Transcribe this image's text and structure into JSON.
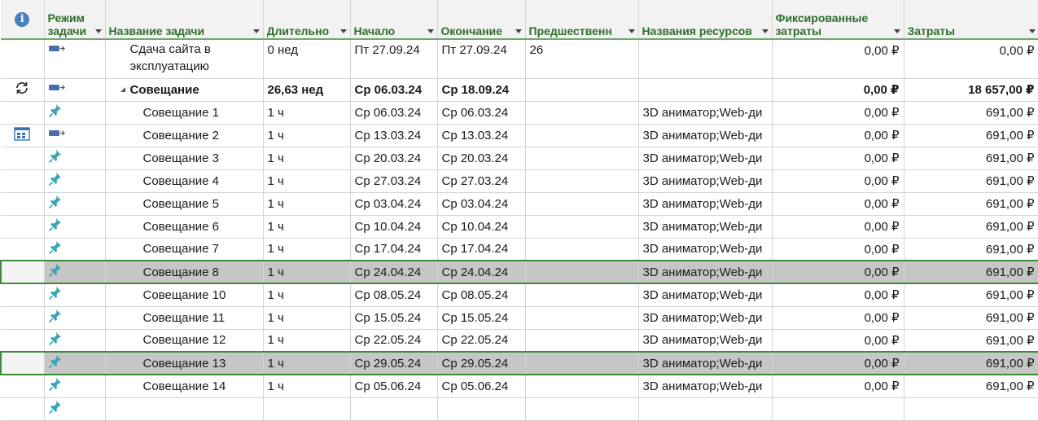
{
  "columns": {
    "info": "i",
    "mode": "Режим задачи",
    "name": "Название задачи",
    "duration": "Длительно",
    "start": "Начало",
    "finish": "Окончание",
    "predecessors": "Предшественн",
    "resources": "Названия ресурсов",
    "fixed_cost": "Фиксированные затраты",
    "cost": "Затраты"
  },
  "rows": [
    {
      "indicator": "",
      "mode_icon": "auto-scheduled-icon",
      "name": "Сдача сайта в эксплуатацию",
      "duration": "0 нед",
      "start": "Пт 27.09.24",
      "finish": "Пт 27.09.24",
      "predecessors": "26",
      "resources": "",
      "fixed_cost": "0,00 ₽",
      "cost": "0,00 ₽"
    },
    {
      "indicator": "recurring-icon",
      "mode_icon": "auto-scheduled-icon",
      "name": "Совещание",
      "duration": "26,63 нед",
      "start": "Ср 06.03.24",
      "finish": "Ср 18.09.24",
      "predecessors": "",
      "resources": "",
      "fixed_cost": "0,00 ₽",
      "cost": "18 657,00 ₽"
    },
    {
      "indicator": "",
      "mode_icon": "manual-pin-icon",
      "name": "Совещание 1",
      "duration": "1 ч",
      "start": "Ср 06.03.24",
      "finish": "Ср 06.03.24",
      "predecessors": "",
      "resources": "3D аниматор;Web-ди",
      "fixed_cost": "0,00 ₽",
      "cost": "691,00 ₽"
    },
    {
      "indicator": "calendar-icon",
      "mode_icon": "auto-scheduled-icon",
      "name": "Совещание 2",
      "duration": "1 ч",
      "start": "Ср 13.03.24",
      "finish": "Ср 13.03.24",
      "predecessors": "",
      "resources": "3D аниматор;Web-ди",
      "fixed_cost": "0,00 ₽",
      "cost": "691,00 ₽"
    },
    {
      "indicator": "",
      "mode_icon": "manual-pin-icon",
      "name": "Совещание 3",
      "duration": "1 ч",
      "start": "Ср 20.03.24",
      "finish": "Ср 20.03.24",
      "predecessors": "",
      "resources": "3D аниматор;Web-ди",
      "fixed_cost": "0,00 ₽",
      "cost": "691,00 ₽"
    },
    {
      "indicator": "",
      "mode_icon": "manual-pin-icon",
      "name": "Совещание 4",
      "duration": "1 ч",
      "start": "Ср 27.03.24",
      "finish": "Ср 27.03.24",
      "predecessors": "",
      "resources": "3D аниматор;Web-ди",
      "fixed_cost": "0,00 ₽",
      "cost": "691,00 ₽"
    },
    {
      "indicator": "",
      "mode_icon": "manual-pin-icon",
      "name": "Совещание 5",
      "duration": "1 ч",
      "start": "Ср 03.04.24",
      "finish": "Ср 03.04.24",
      "predecessors": "",
      "resources": "3D аниматор;Web-ди",
      "fixed_cost": "0,00 ₽",
      "cost": "691,00 ₽"
    },
    {
      "indicator": "",
      "mode_icon": "manual-pin-icon",
      "name": "Совещание 6",
      "duration": "1 ч",
      "start": "Ср 10.04.24",
      "finish": "Ср 10.04.24",
      "predecessors": "",
      "resources": "3D аниматор;Web-ди",
      "fixed_cost": "0,00 ₽",
      "cost": "691,00 ₽"
    },
    {
      "indicator": "",
      "mode_icon": "manual-pin-icon",
      "name": "Совещание 7",
      "duration": "1 ч",
      "start": "Ср 17.04.24",
      "finish": "Ср 17.04.24",
      "predecessors": "",
      "resources": "3D аниматор;Web-ди",
      "fixed_cost": "0,00 ₽",
      "cost": "691,00 ₽"
    },
    {
      "indicator": "",
      "mode_icon": "manual-pin-icon",
      "name": "Совещание 8",
      "duration": "1 ч",
      "start": "Ср 24.04.24",
      "finish": "Ср 24.04.24",
      "predecessors": "",
      "resources": "3D аниматор;Web-ди",
      "fixed_cost": "0,00 ₽",
      "cost": "691,00 ₽",
      "selected": true
    },
    {
      "indicator": "",
      "mode_icon": "manual-pin-icon",
      "name": "Совещание 10",
      "duration": "1 ч",
      "start": "Ср 08.05.24",
      "finish": "Ср 08.05.24",
      "predecessors": "",
      "resources": "3D аниматор;Web-ди",
      "fixed_cost": "0,00 ₽",
      "cost": "691,00 ₽"
    },
    {
      "indicator": "",
      "mode_icon": "manual-pin-icon",
      "name": "Совещание 11",
      "duration": "1 ч",
      "start": "Ср 15.05.24",
      "finish": "Ср 15.05.24",
      "predecessors": "",
      "resources": "3D аниматор;Web-ди",
      "fixed_cost": "0,00 ₽",
      "cost": "691,00 ₽"
    },
    {
      "indicator": "",
      "mode_icon": "manual-pin-icon",
      "name": "Совещание 12",
      "duration": "1 ч",
      "start": "Ср 22.05.24",
      "finish": "Ср 22.05.24",
      "predecessors": "",
      "resources": "3D аниматор;Web-ди",
      "fixed_cost": "0,00 ₽",
      "cost": "691,00 ₽"
    },
    {
      "indicator": "",
      "mode_icon": "manual-pin-icon",
      "name": "Совещание 13",
      "duration": "1 ч",
      "start": "Ср 29.05.24",
      "finish": "Ср 29.05.24",
      "predecessors": "",
      "resources": "3D аниматор;Web-ди",
      "fixed_cost": "0,00 ₽",
      "cost": "691,00 ₽",
      "selected": true
    },
    {
      "indicator": "",
      "mode_icon": "manual-pin-icon",
      "name": "Совещание 14",
      "duration": "1 ч",
      "start": "Ср 05.06.24",
      "finish": "Ср 05.06.24",
      "predecessors": "",
      "resources": "3D аниматор;Web-ди",
      "fixed_cost": "0,00 ₽",
      "cost": "691,00 ₽"
    }
  ],
  "colors": {
    "header_text": "#2f6d2b",
    "selection_border": "#3f8a3a",
    "selection_fill": "#c6c6c6",
    "manual_pin": "#3aa3b5",
    "auto_mode": "#4a6fa8"
  }
}
